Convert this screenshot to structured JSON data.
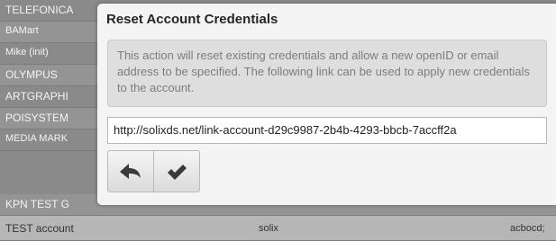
{
  "background_rows": [
    {
      "name": "TELEFONICA",
      "user": "",
      "code": ""
    },
    {
      "name": "BAMart",
      "user": "",
      "code": ""
    },
    {
      "name": "Mike (init)",
      "user": "",
      "code": ""
    },
    {
      "name": "OLYMPUS",
      "user": "",
      "code": ""
    },
    {
      "name": "ARTGRAPHI",
      "user": "",
      "code": ""
    },
    {
      "name": "POISYSTEM",
      "user": "",
      "code": ""
    },
    {
      "name": "MEDIA MARK",
      "user": "",
      "code": ""
    },
    {
      "name": "KPN TEST G",
      "user": "",
      "code": ""
    },
    {
      "name": "TEST account",
      "user": "solix",
      "code": "acbocd;"
    }
  ],
  "dialog": {
    "title": "Reset Account Credentials",
    "notice": "This action will reset existing credentials and allow a new openID or email address to be specified. The following link can be used to apply new credentials to the account.",
    "link_value": "http://solixds.net/link-account-d29c9987-2b4b-4293-bbcb-7accff2a",
    "back_icon": "arrow-left-icon",
    "confirm_icon": "checkmark-icon"
  }
}
